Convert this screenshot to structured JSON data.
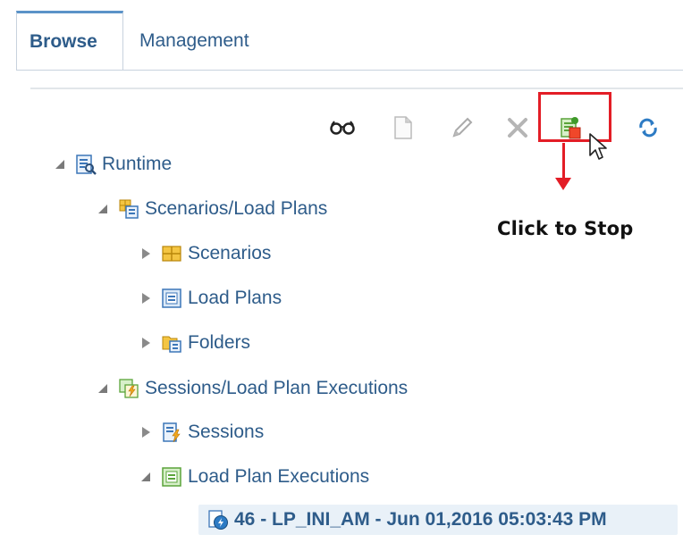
{
  "tabs": [
    {
      "label": "Browse",
      "active": true
    },
    {
      "label": "Management",
      "active": false
    }
  ],
  "toolbar": {
    "buttons": [
      {
        "name": "view-icon"
      },
      {
        "name": "new-icon"
      },
      {
        "name": "edit-icon"
      },
      {
        "name": "delete-icon"
      },
      {
        "name": "stop-execution-icon"
      },
      {
        "name": "refresh-icon"
      }
    ],
    "callout": "Click to Stop",
    "highlight_color": "#e31d26"
  },
  "tree": {
    "runtime": "Runtime",
    "scenarios_load_plans": "Scenarios/Load Plans",
    "scenarios": "Scenarios",
    "load_plans": "Load Plans",
    "folders": "Folders",
    "sessions_lp_executions": "Sessions/Load Plan Executions",
    "sessions": "Sessions",
    "load_plan_executions": "Load Plan Executions",
    "execution_item": "46 - LP_INI_AM - Jun 01,2016 05:03:43 PM"
  },
  "colors": {
    "link": "#2e5c8a",
    "tab_accent": "#5b93c8",
    "selection": "#e9f1f8"
  }
}
